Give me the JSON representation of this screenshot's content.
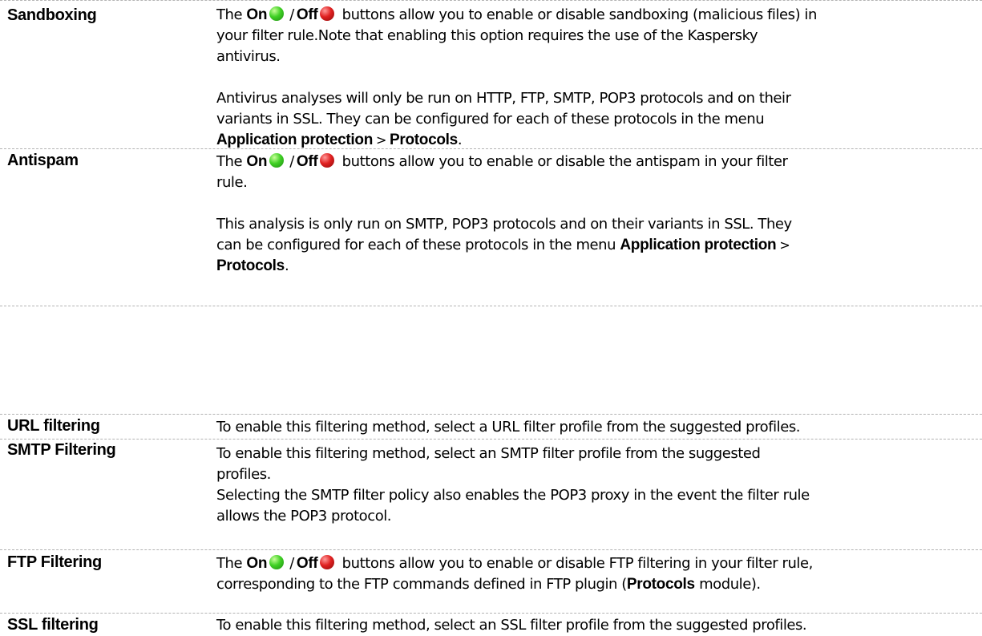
{
  "sandboxing": {
    "term": "Sandboxing",
    "line1_the": "The",
    "on": "On",
    "slash": "/",
    "off": "Off",
    "line1_rest": "buttons allow you to enable or disable sandboxing (malicious files) in",
    "line2": "your filter rule.Note that enabling this option requires the use of the Kaspersky",
    "line3": "antivirus.",
    "p2_line1": "Antivirus analyses will only be run on HTTP, FTP, SMTP, POP3 protocols and on their",
    "p2_line2": "variants in SSL. They can be configured for each of these protocols in the menu",
    "menu_app": "Application protection",
    "gt": ">",
    "menu_protocols": "Protocols",
    "period": "."
  },
  "antispam": {
    "term": "Antispam",
    "line1_the": "The",
    "on": "On",
    "slash": "/",
    "off": "Off",
    "line1_rest": "buttons allow you to enable or disable the antispam in your filter",
    "line2": "rule.",
    "p2_line1": "This analysis is only run on SMTP, POP3 protocols and on their variants in SSL. They",
    "p2_line2": "can be configured for each of these protocols in the menu",
    "menu_app": "Application protection",
    "gt": ">",
    "menu_protocols": "Protocols",
    "period": "."
  },
  "url_filtering": {
    "term": "URL filtering",
    "text": "To enable this filtering method, select a URL filter profile from the suggested profiles."
  },
  "smtp_filtering": {
    "term": "SMTP Filtering",
    "line1": "To enable this filtering method, select an SMTP filter profile from the suggested",
    "line2": "profiles.",
    "line3": "Selecting the SMTP filter policy also enables the POP3 proxy in the event the filter rule",
    "line4": "allows the POP3 protocol."
  },
  "ftp_filtering": {
    "term": "FTP Filtering",
    "line1_the": "The",
    "on": "On",
    "slash": "/",
    "off": "Off",
    "line1_rest": "buttons allow you to enable or disable FTP filtering in your filter rule,",
    "line2_a": "corresponding to the FTP commands defined in FTP plugin (",
    "protocols": "Protocols",
    "line2_b": "module)."
  },
  "ssl_filtering": {
    "term": "SSL filtering",
    "text": "To enable this filtering method, select an SSL filter profile from the suggested profiles."
  },
  "icons": {
    "on": "green-status-dot",
    "off": "red-status-dot"
  },
  "colors": {
    "on": "#3fd024",
    "off": "#e02020",
    "rule": "#b3b3b3"
  }
}
